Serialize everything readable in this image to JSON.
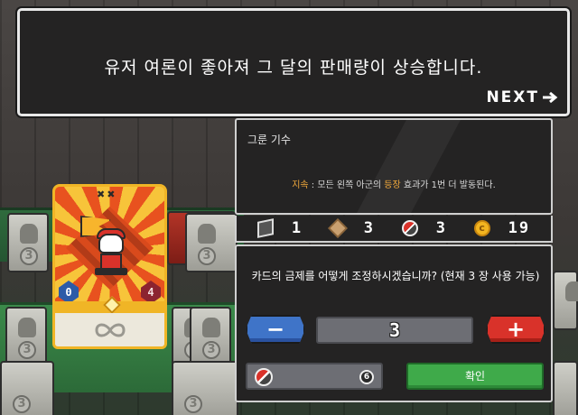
{
  "dialog": {
    "message": "유저 여론이 좋아져 그 달의 판매량이 상승합니다.",
    "next_label": "NEXT"
  },
  "card": {
    "left_stat": "0",
    "right_stat": "4",
    "footer_symbol": "∞"
  },
  "info": {
    "name": "그룬 기수",
    "effect_keyword": "지속",
    "effect_middle": " : 모든 왼쪽 아군의 ",
    "effect_highlight": "등장",
    "effect_end": " 효과가 1번 더 발동된다."
  },
  "resources": [
    {
      "icon": "flag-icon",
      "value": "1"
    },
    {
      "icon": "box-icon",
      "value": "3"
    },
    {
      "icon": "ball-icon",
      "value": "3"
    },
    {
      "icon": "coin-icon",
      "value": "19"
    }
  ],
  "adjust": {
    "question": "카드의 금제를 어떻게 조정하시겠습니까? (현재 3 장 사용 가능)",
    "minus_label": "−",
    "plus_label": "+",
    "value": "3",
    "cost_badge": "6",
    "confirm_label": "확인"
  },
  "colors": {
    "panel_bg": "#242323",
    "accent_orange": "#f2a93b",
    "minus_blue": "#3f74c8",
    "plus_red": "#d9322a",
    "confirm_green": "#3faa4a"
  }
}
